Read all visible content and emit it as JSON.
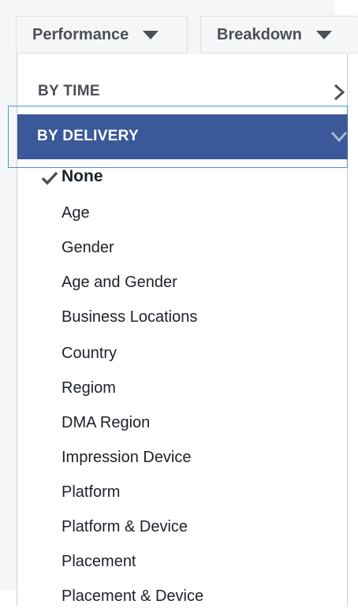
{
  "toolbar": {
    "performance_label": "Performance",
    "breakdown_label": "Breakdown"
  },
  "dropdown": {
    "by_time_label": "BY TIME",
    "by_delivery_label": "BY DELIVERY",
    "options": [
      {
        "label": "None",
        "selected": true
      },
      {
        "label": "Age"
      },
      {
        "label": "Gender"
      },
      {
        "label": "Age and Gender"
      },
      {
        "label": "Business Locations"
      },
      {
        "label": "Country"
      },
      {
        "label": "Regiom"
      },
      {
        "label": "DMA Region"
      },
      {
        "label": "Impression Device"
      },
      {
        "label": "Platform"
      },
      {
        "label": "Platform & Device"
      },
      {
        "label": "Placement"
      },
      {
        "label": "Placement & Device"
      }
    ]
  },
  "colors": {
    "highlight": "#3b5998",
    "focus_outline": "#4a90e2",
    "text": "#1d2129",
    "muted_text": "#4b4f56"
  },
  "icons": {
    "caret": "caret-down-icon",
    "chevron_right": "chevron-right-icon",
    "chevron_down": "chevron-down-icon",
    "check": "checkmark-icon"
  }
}
